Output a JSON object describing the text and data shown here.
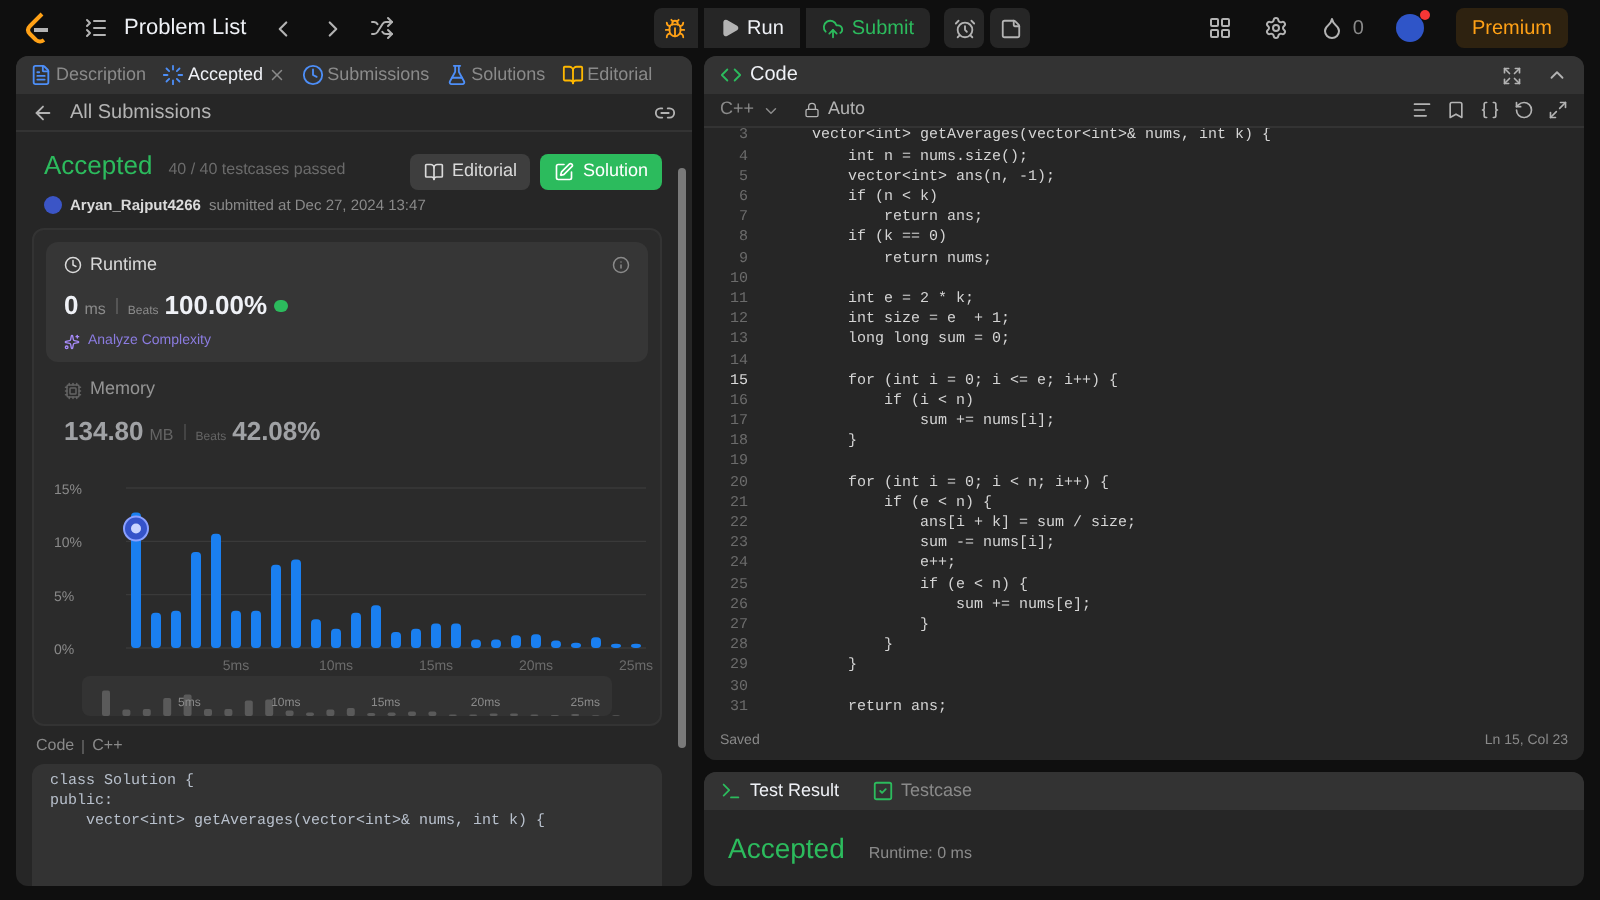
{
  "topbar": {
    "problem_list": "Problem List",
    "run": "Run",
    "submit": "Submit",
    "streak": "0",
    "premium": "Premium",
    "notification": true
  },
  "left_tabs": [
    {
      "label": "Description",
      "kind": "description",
      "selected": false,
      "closable": false
    },
    {
      "label": "Accepted",
      "kind": "accepted",
      "selected": true,
      "closable": true
    },
    {
      "label": "Submissions",
      "kind": "submissions",
      "selected": false,
      "closable": false
    },
    {
      "label": "Solutions",
      "kind": "solutions",
      "selected": false,
      "closable": false
    },
    {
      "label": "Editorial",
      "kind": "editorial",
      "selected": false,
      "closable": false
    }
  ],
  "back_link": "All Submissions",
  "submission": {
    "status": "Accepted",
    "testcases": "40 / 40 testcases passed",
    "user": "Aryan_Rajput4266",
    "submitted": "submitted at Dec 27, 2024 13:47",
    "buttons": [
      {
        "label": "Editorial",
        "kind": "secondary"
      },
      {
        "label": "Solution",
        "kind": "primary"
      }
    ]
  },
  "metrics": [
    {
      "kind": "runtime",
      "title": "Runtime",
      "value": "0",
      "unit": "ms",
      "beats_label": "Beats",
      "beats": "100.00%",
      "link": "Analyze Complexity",
      "selected": true
    },
    {
      "kind": "memory",
      "title": "Memory",
      "value": "134.80",
      "unit": "MB",
      "beats_label": "Beats",
      "beats": "42.08%",
      "selected": false
    }
  ],
  "chart_data": {
    "type": "bar",
    "x": [
      0,
      1,
      2,
      3,
      4,
      5,
      6,
      7,
      8,
      9,
      10,
      11,
      12,
      13,
      14,
      15,
      16,
      17,
      18,
      19,
      20,
      21,
      22,
      23,
      24,
      25
    ],
    "series": [
      {
        "color": "#1a7ff0",
        "values": [
          12.7,
          3.3,
          3.5,
          9,
          10.7,
          3.5,
          3.5,
          7.8,
          8.3,
          2.7,
          1.8,
          3.3,
          4,
          1.5,
          1.8,
          2.3,
          2.3,
          0.8,
          0.8,
          1.2,
          1.3,
          0.7,
          0.5,
          1,
          0.4,
          0.4
        ]
      }
    ],
    "ylim": [
      0,
      15
    ],
    "yticks": [
      {
        "value": 0,
        "label": "0%"
      },
      {
        "value": 5,
        "label": "5%"
      },
      {
        "value": 10,
        "label": "10%"
      },
      {
        "value": 15,
        "label": "15%"
      }
    ],
    "xticks": [
      {
        "value": 5,
        "label": "5ms"
      },
      {
        "value": 10,
        "label": "10ms"
      },
      {
        "value": 15,
        "label": "15ms"
      },
      {
        "value": 20,
        "label": "20ms"
      },
      {
        "value": 25,
        "label": "25ms"
      }
    ],
    "xlim": [
      -0.5,
      25.5
    ]
  },
  "your_submission_marker": true,
  "overview_labels": [
    "5ms",
    "10ms",
    "15ms",
    "20ms",
    "25ms"
  ],
  "code_preview": {
    "label": "Code",
    "language": "C++",
    "lines": [
      "class Solution {",
      "public:",
      "    vector<int> getAverages(vector<int>& nums, int k) {"
    ]
  },
  "editor": {
    "title": "Code",
    "language": "C++",
    "mode": "Auto",
    "status": "Saved",
    "cursor": "Ln 15, Col 23",
    "lines": [
      {
        "number": "3",
        "text": "    vector<int> getAverages(vector<int>& nums, int k) {",
        "active": false
      },
      {
        "number": "4",
        "text": "        int n = nums.size();",
        "active": false
      },
      {
        "number": "5",
        "text": "        vector<int> ans(n, -1);",
        "active": false
      },
      {
        "number": "6",
        "text": "        if (n < k)",
        "active": false
      },
      {
        "number": "7",
        "text": "            return ans;",
        "active": false
      },
      {
        "number": "8",
        "text": "        if (k == 0)",
        "active": false
      },
      {
        "number": "9",
        "text": "            return nums;",
        "active": false
      },
      {
        "number": "10",
        "active": false
      },
      {
        "number": "11",
        "text": "        int e = 2 * k;",
        "active": false
      },
      {
        "number": "12",
        "text": "        int size = e  + 1;",
        "active": false
      },
      {
        "number": "13",
        "text": "        long long sum = 0;",
        "active": false
      },
      {
        "number": "14",
        "active": false
      },
      {
        "number": "15",
        "text": "        for (int i = 0; i <= e; i++) {",
        "active": true
      },
      {
        "number": "16",
        "text": "            if (i < n)",
        "active": false
      },
      {
        "number": "17",
        "text": "                sum += nums[i];",
        "active": false
      },
      {
        "number": "18",
        "text": "        }",
        "active": false
      },
      {
        "number": "19",
        "active": false
      },
      {
        "number": "20",
        "text": "        for (int i = 0; i < n; i++) {",
        "active": false
      },
      {
        "number": "21",
        "text": "            if (e < n) {",
        "active": false
      },
      {
        "number": "22",
        "text": "                ans[i + k] = sum / size;",
        "active": false
      },
      {
        "number": "23",
        "text": "                sum -= nums[i];",
        "active": false
      },
      {
        "number": "24",
        "text": "                e++;",
        "active": false
      },
      {
        "number": "25",
        "text": "                if (e < n) {",
        "active": false
      },
      {
        "number": "26",
        "text": "                    sum += nums[e];",
        "active": false
      },
      {
        "number": "27",
        "text": "                }",
        "active": false
      },
      {
        "number": "28",
        "text": "            }",
        "active": false
      },
      {
        "number": "29",
        "text": "        }",
        "active": false
      },
      {
        "number": "30",
        "active": false
      },
      {
        "number": "31",
        "text": "        return ans;",
        "active": false
      }
    ]
  },
  "test_result": {
    "tabs": [
      {
        "label": "Test Result",
        "kind": "terminal",
        "selected": true
      },
      {
        "label": "Testcase",
        "kind": "checkbox",
        "selected": false
      }
    ],
    "status": "Accepted",
    "runtime": "Runtime: 0 ms"
  }
}
